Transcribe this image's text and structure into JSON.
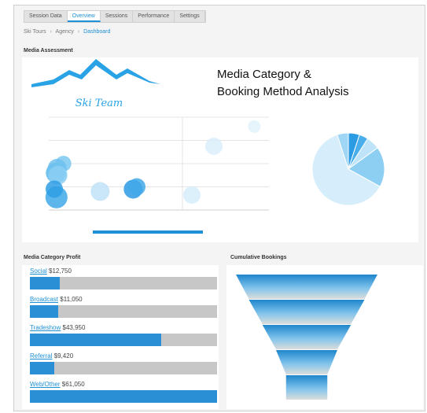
{
  "tabs": [
    {
      "label": "Session Data"
    },
    {
      "label": "Overview"
    },
    {
      "label": "Sessions"
    },
    {
      "label": "Performance"
    },
    {
      "label": "Settings"
    }
  ],
  "active_tab_index": 1,
  "breadcrumb": {
    "items": [
      "Ski Tours",
      "Agency",
      "Dashboard"
    ]
  },
  "media_section_title": "Media Assessment",
  "header": {
    "logo_text": "Ski Team",
    "title_line1": "Media Category &",
    "title_line2": "Booking Method Analysis"
  },
  "media_profit": {
    "title": "Media Category Profit",
    "items": [
      {
        "name": "Social",
        "amount": "$12,750",
        "fraction": 0.16
      },
      {
        "name": "Broadcast",
        "amount": "$11,050",
        "fraction": 0.15
      },
      {
        "name": "Tradeshow",
        "amount": "$43,950",
        "fraction": 0.7
      },
      {
        "name": "Referral",
        "amount": "$9,420",
        "fraction": 0.13
      },
      {
        "name": "Web/Other",
        "amount": "$61,050",
        "fraction": 1.0
      }
    ]
  },
  "funnel_title": "Cumulative Bookings",
  "colors": {
    "accent": "#1e90d6",
    "bubble": "#29a3e6",
    "track": "#c7c7c7"
  },
  "chart_data": [
    {
      "type": "scatter",
      "series": [
        {
          "values": [
            [
              2,
              3.2
            ],
            [
              4,
              4.0
            ],
            [
              2.3,
              3.6
            ],
            [
              2.5,
              3.0
            ],
            [
              2.1,
              1.1
            ],
            [
              1.5,
              1.8
            ],
            [
              14,
              1.6
            ],
            [
              23,
              1.8
            ],
            [
              24,
              2.0
            ],
            [
              39,
              1.3
            ],
            [
              45,
              5.5
            ],
            [
              56,
              7.2
            ]
          ]
        }
      ]
    },
    {
      "type": "pie",
      "values": [
        5,
        4,
        6,
        18,
        62,
        5
      ]
    },
    {
      "type": "bar",
      "categories": [
        "Social",
        "Broadcast",
        "Tradeshow",
        "Referral",
        "Web/Other"
      ],
      "values": [
        12750,
        11050,
        43950,
        9420,
        61050
      ]
    },
    {
      "type": "funnel",
      "values": [
        100,
        78,
        55,
        32,
        15
      ]
    }
  ]
}
